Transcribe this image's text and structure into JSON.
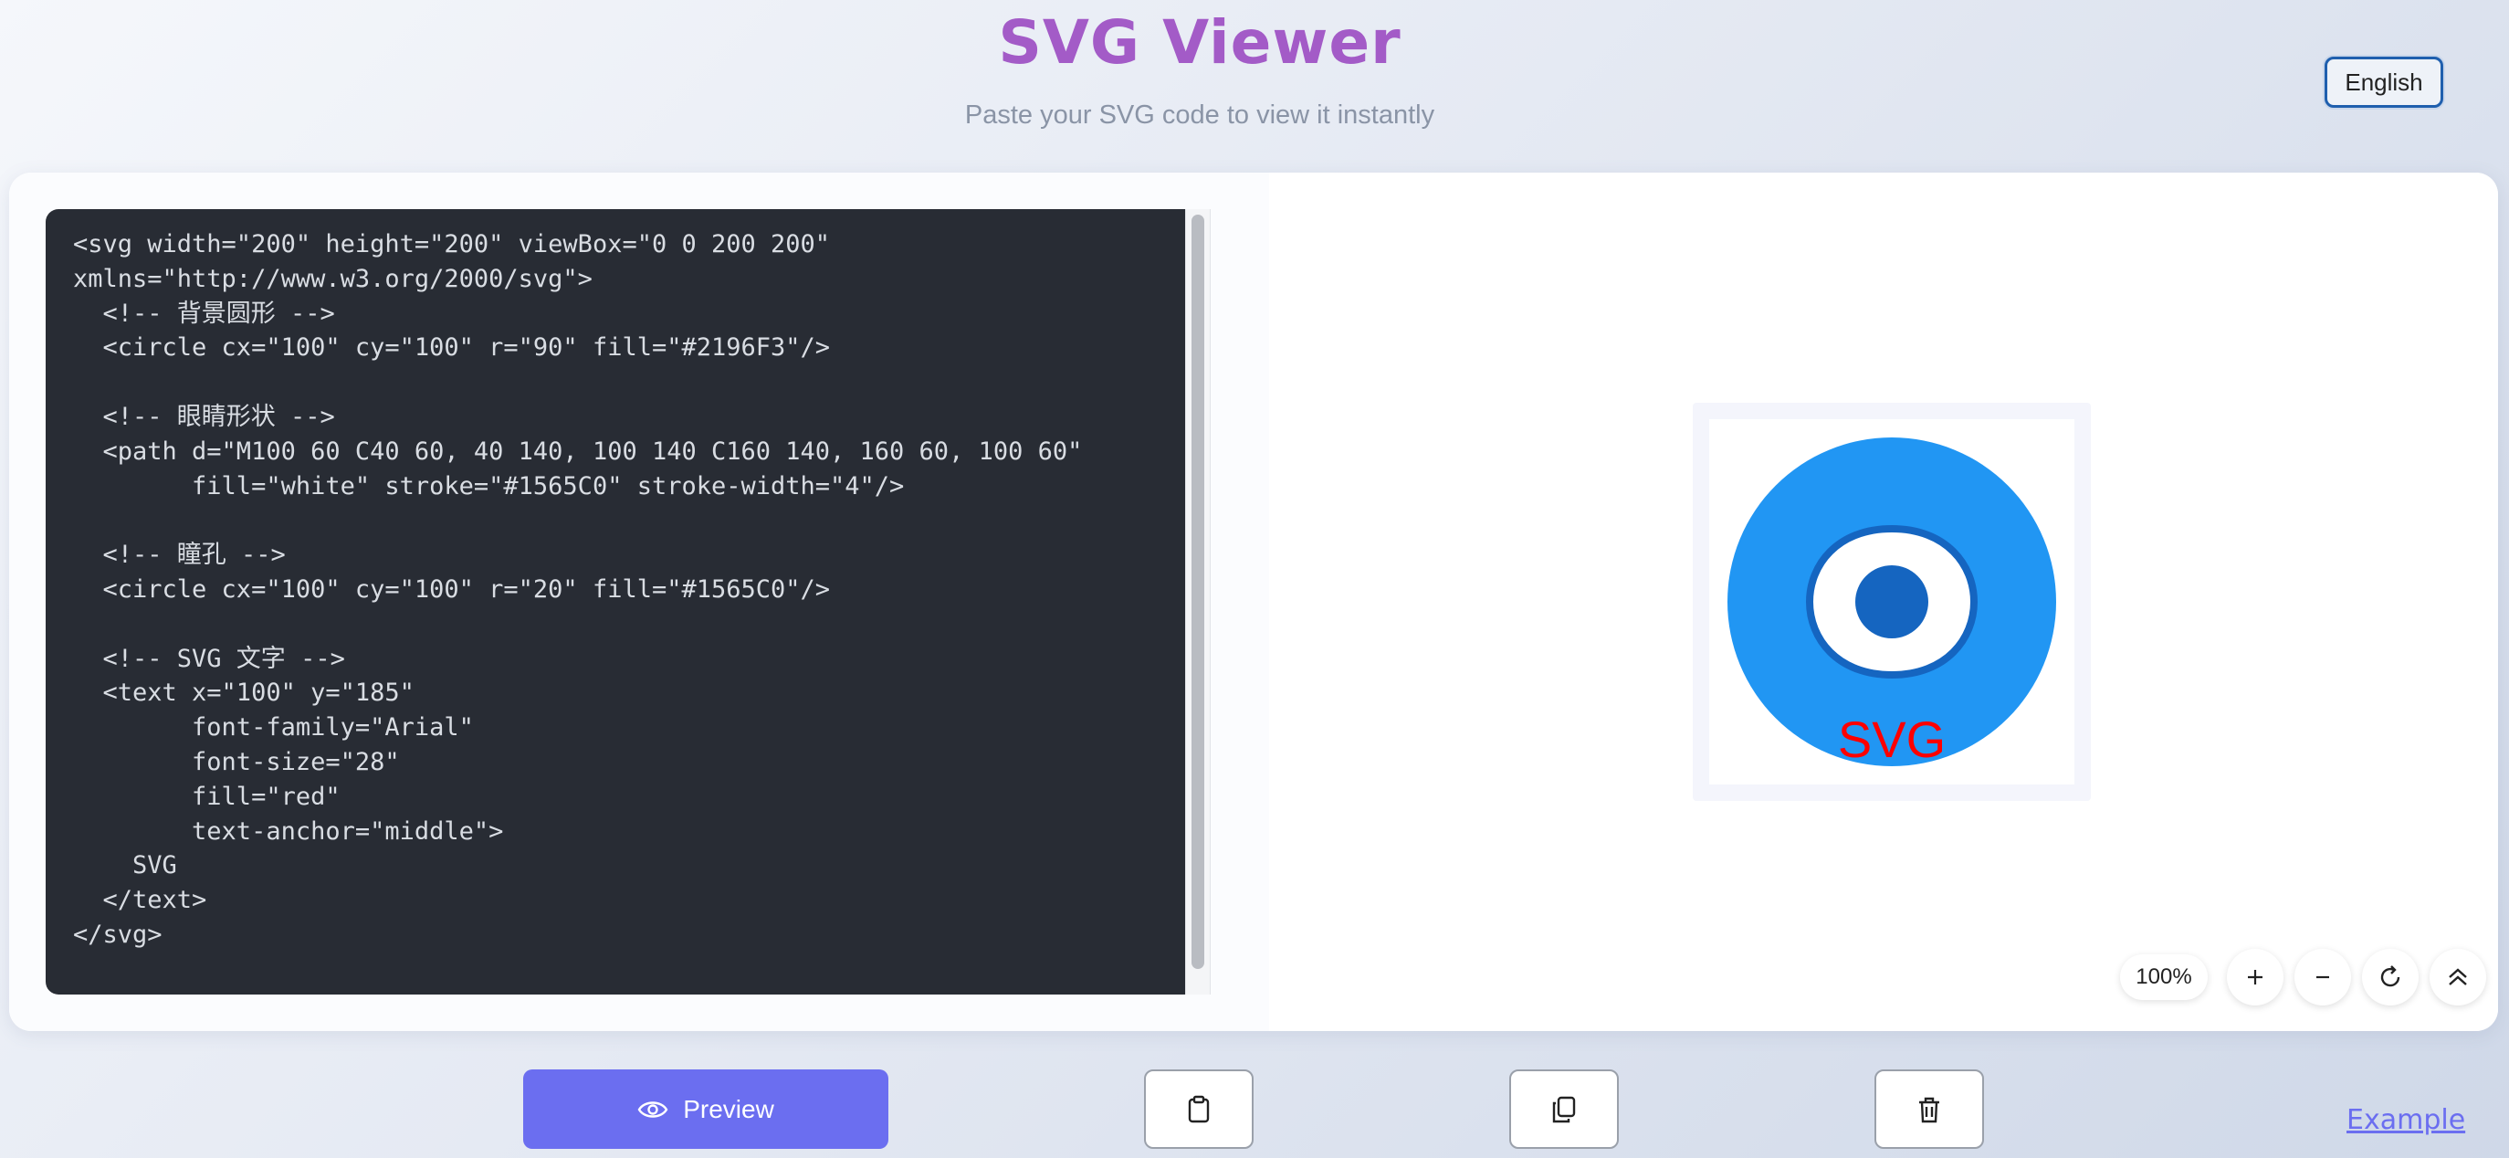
{
  "header": {
    "title": "SVG Viewer",
    "subtitle": "Paste your SVG code to view it instantly",
    "language_label": "English"
  },
  "editor": {
    "code": "<svg width=\"200\" height=\"200\" viewBox=\"0 0 200 200\"\nxmlns=\"http://www.w3.org/2000/svg\">\n  <!-- 背景圆形 -->\n  <circle cx=\"100\" cy=\"100\" r=\"90\" fill=\"#2196F3\"/>\n\n  <!-- 眼睛形状 -->\n  <path d=\"M100 60 C40 60, 40 140, 100 140 C160 140, 160 60, 100 60\"\n        fill=\"white\" stroke=\"#1565C0\" stroke-width=\"4\"/>\n\n  <!-- 瞳孔 -->\n  <circle cx=\"100\" cy=\"100\" r=\"20\" fill=\"#1565C0\"/>\n\n  <!-- SVG 文字 -->\n  <text x=\"100\" y=\"185\"\n        font-family=\"Arial\"\n        font-size=\"28\"\n        fill=\"red\"\n        text-anchor=\"middle\">\n    SVG\n  </text>\n</svg>"
  },
  "preview": {
    "svg_text": "SVG",
    "circle_color": "#2196F3",
    "pupil_color": "#1565C0",
    "text_color": "red",
    "zoom_label": "100%",
    "zoom_in_icon": "plus-icon",
    "zoom_out_icon": "minus-icon",
    "reset_icon": "rotate-icon",
    "collapse_icon": "double-chevron-up-icon"
  },
  "actions": {
    "preview_label": "Preview",
    "preview_icon": "eye-icon",
    "paste_icon": "clipboard-icon",
    "copy_icon": "copy-icon",
    "clear_icon": "trash-icon",
    "example_label": "Example"
  },
  "colors": {
    "title": "#a35bc7",
    "primary_button": "#6b6ef0",
    "editor_bg": "#282c34"
  }
}
